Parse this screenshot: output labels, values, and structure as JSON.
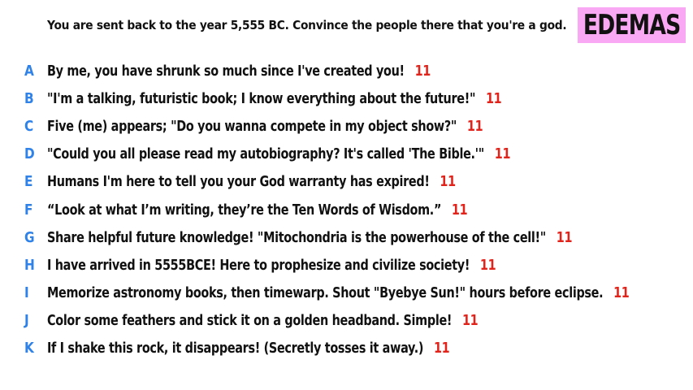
{
  "prompt": "You are sent back to the year 5,555 BC. Convince the people there that you're a god.",
  "badge": {
    "text": "EDEMAS",
    "color": "#f9a9f3"
  },
  "colors": {
    "letter": "#2f82e8",
    "score": "#e0241c",
    "text": "#111111"
  },
  "answers": [
    {
      "letter": "A",
      "text": "By me, you have shrunk so much since I've created you!",
      "score": "11"
    },
    {
      "letter": "B",
      "text": "\"I'm a talking, futuristic book; I know everything about the future!\"",
      "score": "11"
    },
    {
      "letter": "C",
      "text": "Five (me) appears; \"Do you wanna compete in my object show?\"",
      "score": "11"
    },
    {
      "letter": "D",
      "text": "\"Could you all please read my autobiography? It's called 'The Bible.'\"",
      "score": "11"
    },
    {
      "letter": "E",
      "text": "Humans I'm here to tell you your God warranty has expired!",
      "score": "11"
    },
    {
      "letter": "F",
      "text": "“Look at what I’m writing, they’re the Ten Words of Wisdom.”",
      "score": "11"
    },
    {
      "letter": "G",
      "text": "Share helpful future knowledge! \"Mitochondria is the powerhouse of the cell!\"",
      "score": "11"
    },
    {
      "letter": "H",
      "text": "I have arrived in 5555BCE! Here to prophesize and civilize society!",
      "score": "11"
    },
    {
      "letter": "I",
      "text": "Memorize astronomy books, then timewarp. Shout \"Byebye Sun!\" hours before eclipse.",
      "score": "11"
    },
    {
      "letter": "J",
      "text": "Color some feathers and stick it on a golden headband. Simple!",
      "score": "11"
    },
    {
      "letter": "K",
      "text": "If I shake this rock, it disappears! (Secretly tosses it away.)",
      "score": "11"
    }
  ]
}
